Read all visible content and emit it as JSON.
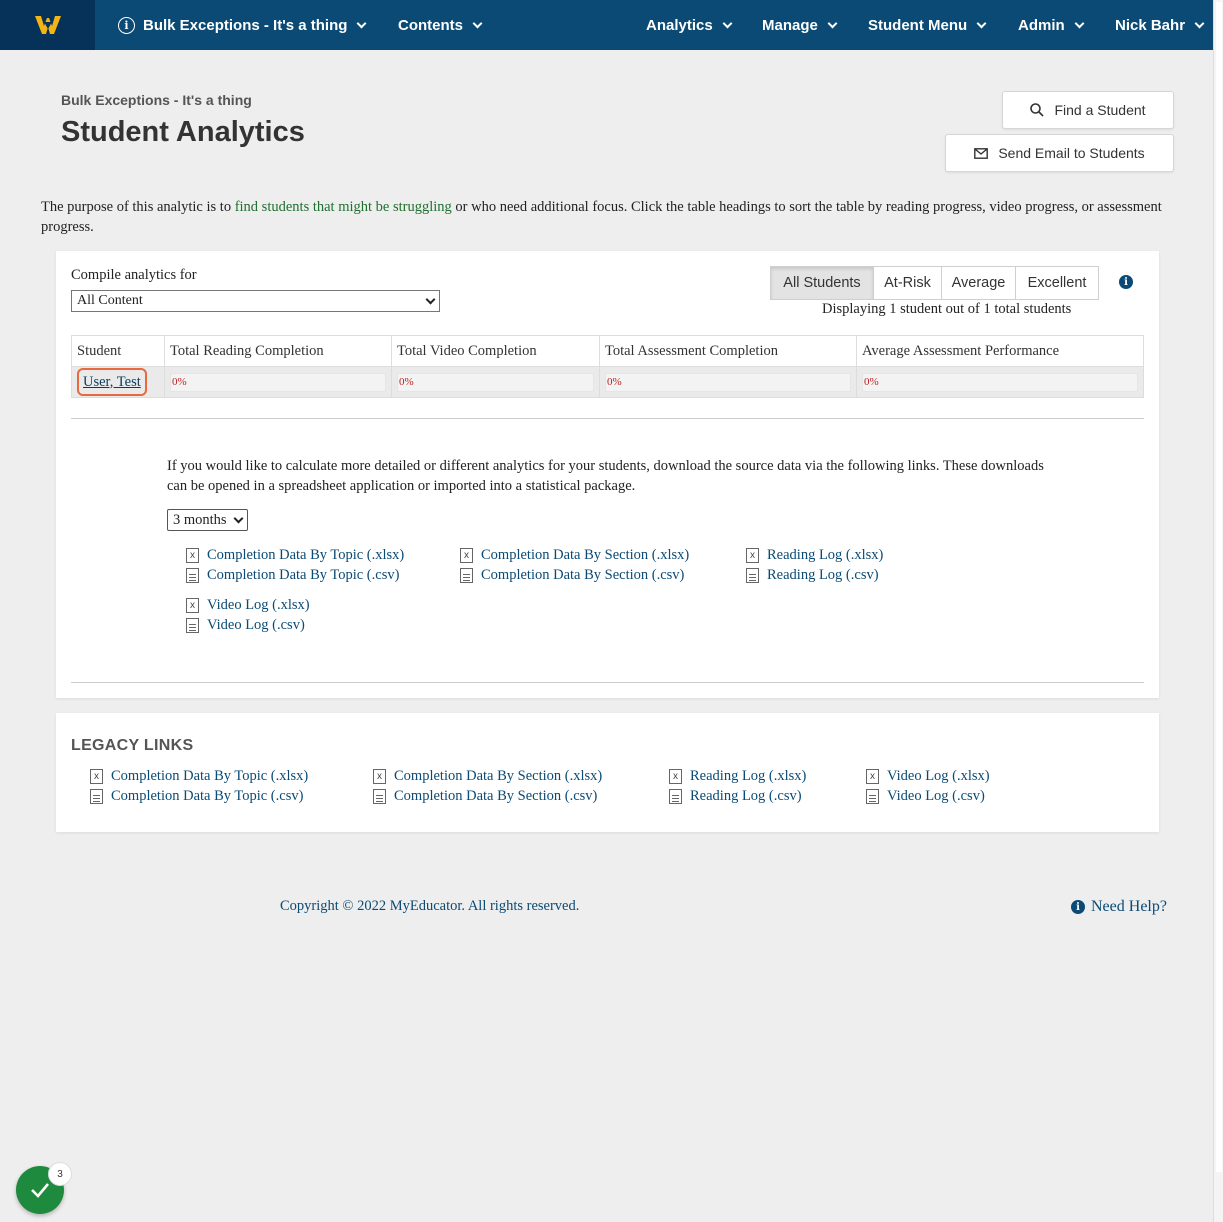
{
  "nav": {
    "course": "Bulk Exceptions - It's a thing",
    "contents": "Contents",
    "analytics": "Analytics",
    "manage": "Manage",
    "student_menu": "Student Menu",
    "admin": "Admin",
    "user": "Nick Bahr"
  },
  "header": {
    "breadcrumb": "Bulk Exceptions - It's a thing",
    "title": "Student Analytics",
    "find_student": "Find a Student",
    "send_email": "Send Email to Students"
  },
  "intro": {
    "before": "The purpose of this analytic is to ",
    "link": "find students that might be struggling",
    "after": " or who need additional focus. Click the table headings to sort the table by reading progress, video progress, or assessment progress."
  },
  "filters": {
    "compile_label": "Compile analytics for",
    "compile_value": "All Content",
    "groups": [
      "All Students",
      "At-Risk",
      "Average",
      "Excellent"
    ],
    "active_group": "All Students",
    "displaying": "Displaying 1 student out of 1 total students"
  },
  "table": {
    "headers": [
      "Student",
      "Total Reading Completion",
      "Total Video Completion",
      "Total Assessment Completion",
      "Average Assessment Performance"
    ],
    "rows": [
      {
        "student": "User, Test",
        "reading": "0%",
        "video": "0%",
        "assessment": "0%",
        "performance": "0%"
      }
    ]
  },
  "downloads": {
    "text": "If you would like to calculate more detailed or different analytics for your students, download the source data via the following links. These downloads can be opened in a spreadsheet application or imported into a statistical package.",
    "period": "3 months",
    "links": {
      "topic_xlsx": "Completion Data By Topic (.xlsx)",
      "topic_csv": "Completion Data By Topic (.csv)",
      "section_xlsx": "Completion Data By Section (.xlsx)",
      "section_csv": "Completion Data By Section (.csv)",
      "reading_xlsx": "Reading Log (.xlsx)",
      "reading_csv": "Reading Log (.csv)",
      "video_xlsx": "Video Log (.xlsx)",
      "video_csv": "Video Log (.csv)"
    }
  },
  "legacy": {
    "title": "LEGACY LINKS"
  },
  "footer": {
    "copyright": "Copyright © 2022 MyEducator. All rights reserved.",
    "help": "Need Help?"
  },
  "fab": {
    "badge": "3"
  },
  "colors": {
    "nav": "#0a4a74",
    "accent_green": "#1f6f2e",
    "highlight": "#e8693d"
  }
}
